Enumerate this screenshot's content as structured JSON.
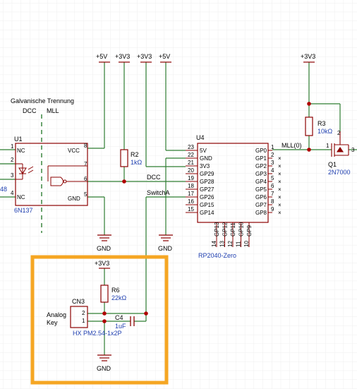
{
  "colors": {
    "background": "#ffffff",
    "grid": "#eeeeee",
    "wire": "#2e7d32",
    "component": "#8b0000",
    "junction": "#b00000",
    "label_blue": "#1f3fb0",
    "highlight": "#f5a623"
  },
  "net_labels": {
    "p5v_a": "+5V",
    "p3v3_a": "+3V3",
    "p3v3_b": "+3V3",
    "p5v_b": "+5V",
    "p3v3_c": "+3V3",
    "p3v3_d": "+3V3",
    "gnd_a": "GND",
    "gnd_b": "GND",
    "gnd_c": "GND",
    "dcc": "DCC",
    "switch_a": "SwitchA",
    "mll0": "MLL(0)"
  },
  "isolation": {
    "title": "Galvanische Trennung",
    "left": "DCC",
    "right": "MLL"
  },
  "u1": {
    "ref": "U1",
    "value": "6N137",
    "left_pins": [
      {
        "num": "1",
        "name": "NC"
      },
      {
        "num": "2",
        "name": ""
      },
      {
        "num": "3",
        "name": ""
      },
      {
        "num": "4",
        "name": "NC"
      }
    ],
    "right_pins": [
      {
        "num": "8",
        "name": "VCC"
      },
      {
        "num": "7",
        "name": ""
      },
      {
        "num": "6",
        "name": ""
      },
      {
        "num": "5",
        "name": "GND"
      }
    ],
    "left_edge_text": "48"
  },
  "r2": {
    "ref": "R2",
    "value": "1kΩ"
  },
  "r3": {
    "ref": "R3",
    "value": "10kΩ"
  },
  "r6": {
    "ref": "R6",
    "value": "22kΩ"
  },
  "c4": {
    "ref": "C4",
    "value": "1uF"
  },
  "q1": {
    "ref": "Q1",
    "value": "2N7000",
    "pins": [
      {
        "num": "1"
      },
      {
        "num": "2"
      },
      {
        "num": "3"
      }
    ]
  },
  "u4": {
    "ref": "U4",
    "value": "RP2040-Zero",
    "left_pins": [
      {
        "num": "23",
        "name": "5V"
      },
      {
        "num": "22",
        "name": "GND"
      },
      {
        "num": "21",
        "name": "3V3"
      },
      {
        "num": "20",
        "name": "GP29"
      },
      {
        "num": "19",
        "name": "GP28"
      },
      {
        "num": "18",
        "name": "GP27"
      },
      {
        "num": "17",
        "name": "GP26"
      },
      {
        "num": "16",
        "name": "GP15"
      },
      {
        "num": "15",
        "name": "GP14"
      }
    ],
    "right_pins": [
      {
        "num": "1",
        "name": "GP0"
      },
      {
        "num": "2",
        "name": "GP1"
      },
      {
        "num": "3",
        "name": "GP2"
      },
      {
        "num": "4",
        "name": "GP3"
      },
      {
        "num": "5",
        "name": "GP4"
      },
      {
        "num": "6",
        "name": "GP5"
      },
      {
        "num": "7",
        "name": "GP6"
      },
      {
        "num": "8",
        "name": "GP7"
      },
      {
        "num": "9",
        "name": "GP8"
      }
    ],
    "bottom_pins": [
      {
        "num": "14",
        "name": "GP13"
      },
      {
        "num": "13",
        "name": "GP12"
      },
      {
        "num": "12",
        "name": "GP11"
      },
      {
        "num": "11",
        "name": "GP10"
      },
      {
        "num": "10",
        "name": "GP9"
      }
    ]
  },
  "cn3": {
    "ref": "CN3",
    "value": "HX PM2.54-1x2P",
    "description_line1": "Analog",
    "description_line2": "Key",
    "pins": [
      {
        "num": "2"
      },
      {
        "num": "1"
      }
    ]
  }
}
